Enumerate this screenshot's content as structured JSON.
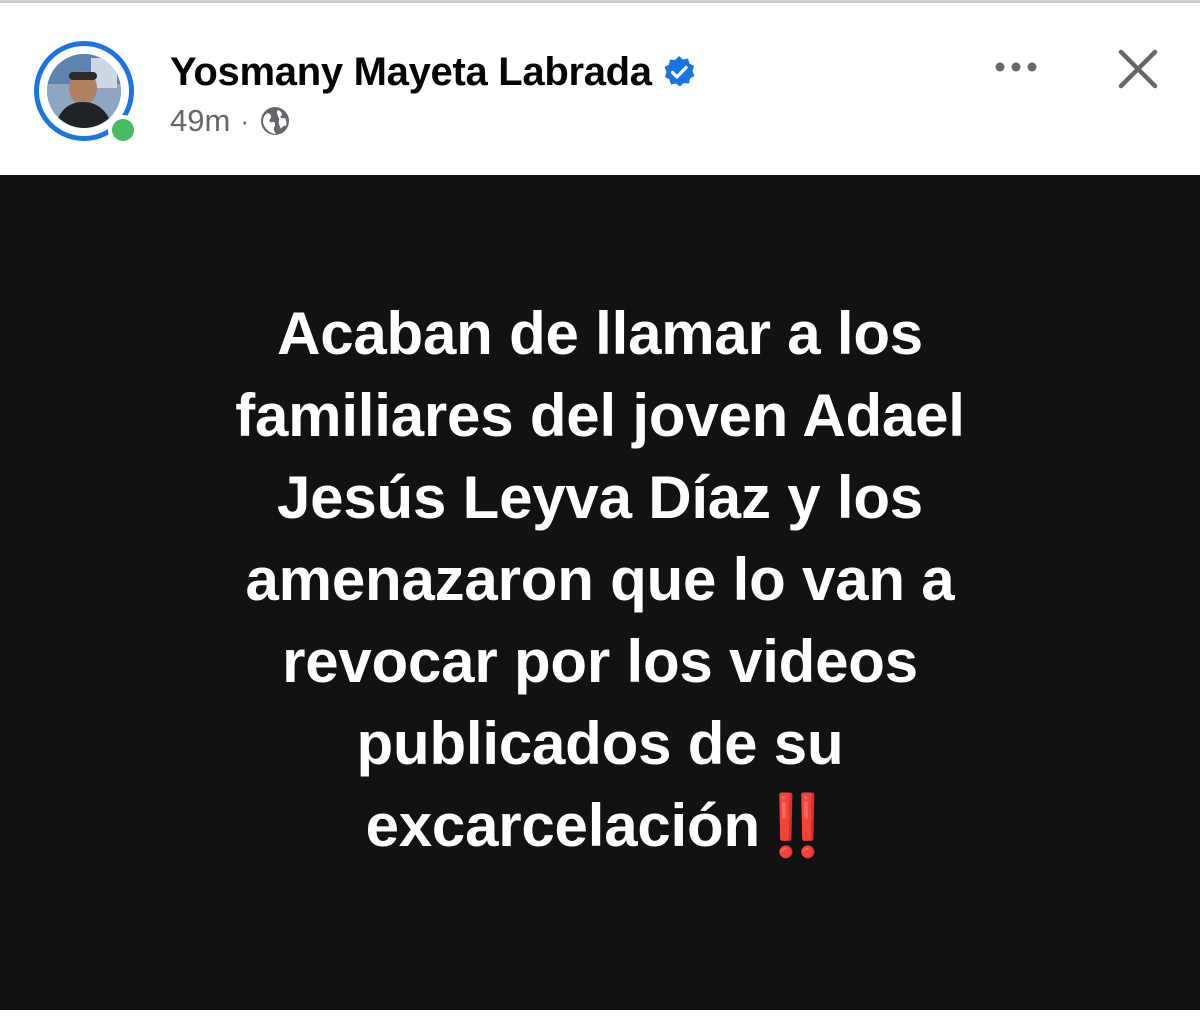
{
  "post": {
    "author_name": "Yosmany Mayeta Labrada",
    "verified": true,
    "timestamp": "49m",
    "separator": "·",
    "audience_icon": "globe-icon",
    "online_status": "online",
    "actions": {
      "more_icon": "more-horizontal-icon",
      "close_icon": "close-icon"
    }
  },
  "image_text": {
    "lines": [
      "Acaban de llamar a los",
      "familiares del joven Adael",
      "Jesús Leyva Díaz y los",
      "amenazaron que lo van a",
      "revocar por los videos",
      "publicados de su"
    ],
    "last_line": "excarcelación",
    "last_line_emoji": "‼️"
  },
  "colors": {
    "verified_blue": "#1b74e4",
    "online_green": "#45bd62",
    "image_background": "#121212",
    "image_text": "#ffffff",
    "exclamation_red": "#e0241b",
    "meta_gray": "#65676b"
  }
}
